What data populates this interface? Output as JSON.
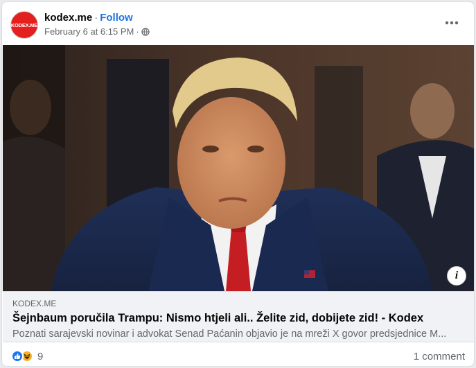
{
  "post": {
    "author": "kodex.me",
    "avatar_text": "KODEX.ME",
    "separator": "·",
    "follow_label": "Follow",
    "timestamp": "February 6 at 6:15 PM",
    "privacy_icon": "globe-icon",
    "more_icon": "more-options-icon"
  },
  "photo": {
    "info_icon_label": "i"
  },
  "link": {
    "domain": "KODEX.ME",
    "title": "Šejnbaum poručila Trampu: Nismo htjeli ali.. Želite zid, dobijete zid! - Kodex",
    "description": "Poznati sarajevski novinar i advokat Senad Paćanin objavio je na mreži X govor predsjednice M..."
  },
  "footer": {
    "reactions": [
      "like-icon",
      "haha-icon"
    ],
    "reaction_count": "9",
    "comments": "1 comment"
  },
  "colors": {
    "accent": "#1b74e4",
    "brand_red": "#e4201f",
    "muted": "#65676b"
  }
}
